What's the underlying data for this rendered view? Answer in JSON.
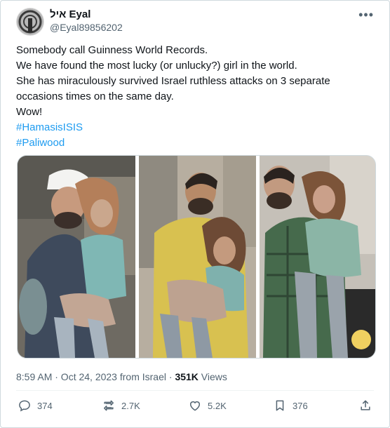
{
  "author": {
    "display_name": "איל Eyal",
    "handle": "@Eyal89856202"
  },
  "tweet": {
    "lines": [
      "Somebody call Guinness World Records.",
      "We have found the most lucky (or unlucky?) girl in the world.",
      "She has miraculously survived Israel ruthless attacks on 3 separate",
      "occasions times on the same day.",
      "Wow!"
    ],
    "hashtags": [
      "#HamasisISIS",
      "#Paliwood"
    ]
  },
  "media": {
    "panels": 3
  },
  "meta": {
    "timestamp": "8:59 AM · Oct 24, 2023 from Israel · ",
    "views_count": "351K",
    "views_label": " Views"
  },
  "actions": {
    "replies": "374",
    "reposts": "2.7K",
    "likes": "5.2K",
    "bookmarks": "376"
  },
  "icons": [
    "more-icon",
    "reply-icon",
    "repost-icon",
    "like-icon",
    "bookmark-icon",
    "share-icon"
  ]
}
